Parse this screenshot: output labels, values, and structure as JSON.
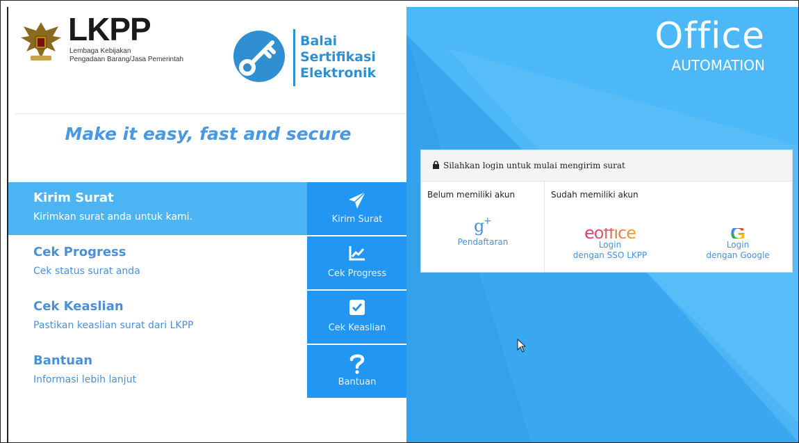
{
  "lkpp": {
    "title": "LKPP",
    "subtitle_line1": "Lembaga Kebijakan",
    "subtitle_line2": "Pengadaan Barang/Jasa Pemerintah"
  },
  "bse": {
    "line1": "Balai",
    "line2": "Sertifikasi",
    "line3": "Elektronik"
  },
  "tagline": "Make it easy, fast and secure",
  "menu": [
    {
      "title": "Kirim Surat",
      "desc": "Kirimkan surat anda untuk kami.",
      "button": "Kirim Surat",
      "icon": "paper-plane-icon",
      "active": true
    },
    {
      "title": "Cek Progress",
      "desc": "Cek status surat anda",
      "button": "Cek Progress",
      "icon": "chart-line-icon",
      "active": false
    },
    {
      "title": "Cek Keaslian",
      "desc": "Pastikan keaslian surat dari LKPP",
      "button": "Cek Keaslian",
      "icon": "check-square-icon",
      "active": false
    },
    {
      "title": "Bantuan",
      "desc": "Informasi lebih lanjut",
      "button": "Bantuan",
      "icon": "question-icon",
      "active": false
    }
  ],
  "office": {
    "title": "Office",
    "subtitle": "AUTOMATION"
  },
  "login": {
    "header": "Silahkan login untuk mulai mengirim surat",
    "left_heading": "Belum memiliki akun",
    "right_heading": "Sudah memiliki akun",
    "register": {
      "label": "Pendaftaran",
      "icon": "google-plus-icon"
    },
    "sso": {
      "brand": "eoffice",
      "line1": "Login",
      "line2": "dengan SSO LKPP"
    },
    "google": {
      "brand": "G",
      "line1": "Login",
      "line2": "dengan Google"
    }
  },
  "colors": {
    "accent": "#4a98e0",
    "active_menu": "#4db4f3",
    "button": "#2196f3",
    "right_bg": "#4db8f7"
  }
}
